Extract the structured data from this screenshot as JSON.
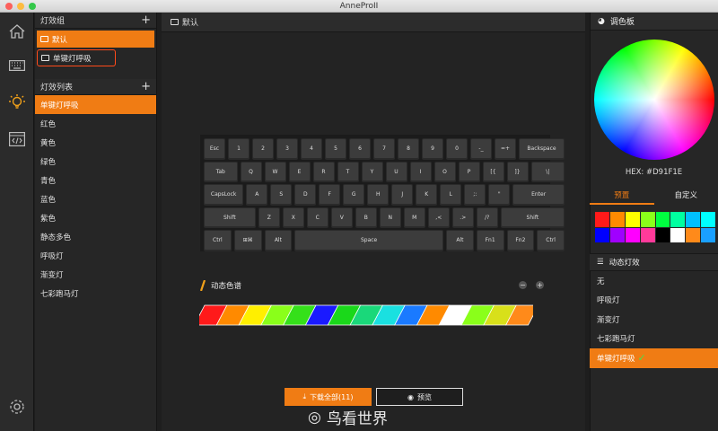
{
  "window": {
    "title": "AnneProII"
  },
  "left": {
    "groups_title": "灯效组",
    "groups": [
      {
        "label": "默认",
        "active": true
      },
      {
        "label": "单键灯呼吸",
        "outlined": true
      }
    ],
    "effects_title": "灯效列表",
    "effects": [
      {
        "label": "单键灯呼吸",
        "active": true
      },
      {
        "label": "红色"
      },
      {
        "label": "黄色"
      },
      {
        "label": "绿色"
      },
      {
        "label": "青色"
      },
      {
        "label": "蓝色"
      },
      {
        "label": "紫色"
      },
      {
        "label": "静态多色"
      },
      {
        "label": "呼吸灯"
      },
      {
        "label": "渐变灯"
      },
      {
        "label": "七彩跑马灯"
      }
    ]
  },
  "center": {
    "title": "默认",
    "keyboard_rows": [
      [
        "Esc",
        "1",
        "2",
        "3",
        "4",
        "5",
        "6",
        "7",
        "8",
        "9",
        "0",
        "-_",
        "=+",
        "Backspace"
      ],
      [
        "Tab",
        "Q",
        "W",
        "E",
        "R",
        "T",
        "Y",
        "U",
        "I",
        "O",
        "P",
        "[{",
        "]}",
        "\\|"
      ],
      [
        "CapsLock",
        "A",
        "S",
        "D",
        "F",
        "G",
        "H",
        "J",
        "K",
        "L",
        ";:",
        "\"",
        "Enter"
      ],
      [
        "Shift",
        "Z",
        "X",
        "C",
        "V",
        "B",
        "N",
        "M",
        ",<",
        ".>",
        "/?",
        "Shift"
      ],
      [
        "Ctrl",
        "⊞⌘",
        "Alt",
        "Space",
        "Alt",
        "Fn1",
        "Fn2",
        "Ctrl"
      ]
    ],
    "palette_title": "动态色谱",
    "zoom_minus": "−",
    "zoom_plus": "+",
    "spectrum_colors": [
      "#ff1a1a",
      "#ff8a00",
      "#ffef00",
      "#8aff1a",
      "#35e01a",
      "#1a1aff",
      "#1ad81a",
      "#1ad87a",
      "#1ae0e0",
      "#1a7aff",
      "#ff8a00",
      "#ffffff",
      "#8aff1a",
      "#d8e01a",
      "#ff8a1a"
    ],
    "download_label": "下载全部(11)",
    "preview_label": "预览"
  },
  "right": {
    "palette_title": "调色板",
    "hex_label": "HEX: #D91F1E",
    "tab_preset": "预置",
    "tab_custom": "自定义",
    "swatches": [
      "#ff1a1a",
      "#ff8a00",
      "#ffff00",
      "#8aff1a",
      "#00ff40",
      "#00ffa0",
      "#00c0ff",
      "#00ffff",
      "#0000ff",
      "#a000ff",
      "#ff00ff",
      "#ff3a9a",
      "#000000",
      "#ffffff",
      "#ff8a1a",
      "#1aa0ff"
    ],
    "dynamic_title": "动态灯效",
    "dynamic_items": [
      {
        "label": "无"
      },
      {
        "label": "呼吸灯"
      },
      {
        "label": "渐变灯"
      },
      {
        "label": "七彩跑马灯"
      },
      {
        "label": "单键灯呼吸",
        "active": true
      }
    ]
  },
  "watermark": "鸟看世界"
}
